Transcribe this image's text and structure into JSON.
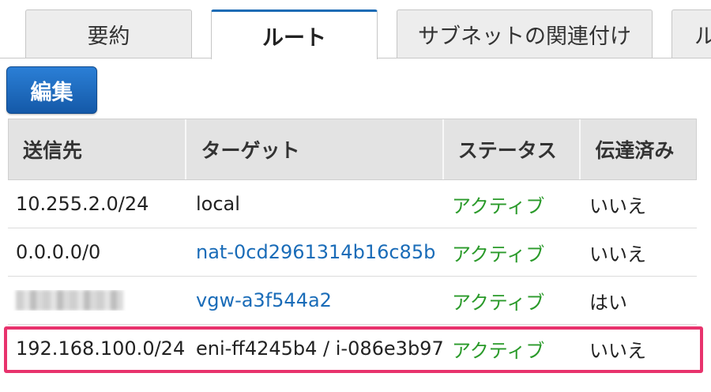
{
  "tabs": [
    {
      "label": "要約",
      "active": false
    },
    {
      "label": "ルート",
      "active": true
    },
    {
      "label": "サブネットの関連付け",
      "active": false
    },
    {
      "label": "ル",
      "active": false
    }
  ],
  "edit_button": "編集",
  "table": {
    "headers": [
      "送信先",
      "ターゲット",
      "ステータス",
      "伝達済み"
    ],
    "rows": [
      {
        "destination": "10.255.2.0/24",
        "target": "local",
        "target_is_link": false,
        "status": "アクティブ",
        "propagated": "いいえ"
      },
      {
        "destination": "0.0.0.0/0",
        "target": "nat-0cd2961314b16c85b",
        "target_is_link": true,
        "status": "アクティブ",
        "propagated": "いいえ"
      },
      {
        "destination": "",
        "destination_redacted": true,
        "target": "vgw-a3f544a2",
        "target_is_link": true,
        "status": "アクティブ",
        "propagated": "はい"
      },
      {
        "destination": "192.168.100.0/24",
        "target": "eni-ff4245b4 / i-086e3b97",
        "target_is_link": false,
        "status": "アクティブ",
        "propagated": "いいえ",
        "highlighted": true
      }
    ]
  },
  "colors": {
    "accent": "#1c6bb5",
    "link": "#1a6cb8",
    "status_active": "#2a9a2a",
    "highlight": "#e8336d"
  }
}
